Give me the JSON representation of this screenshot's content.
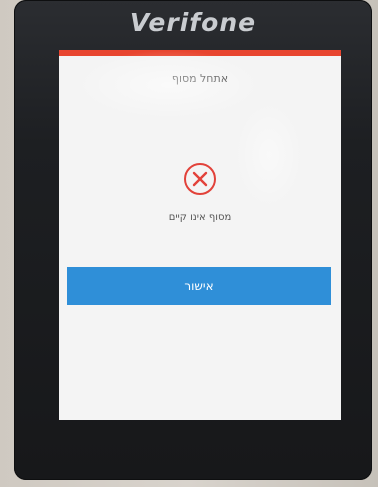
{
  "device": {
    "brand": "Verifone"
  },
  "screen": {
    "title": "אתחל מסוף",
    "message": "מסוף אינו קיים",
    "confirm_label": "אישור",
    "error_icon": "x-circle-icon"
  },
  "colors": {
    "topbar": "#e8452f",
    "error": "#e2423a",
    "button": "#2f8fd8"
  }
}
